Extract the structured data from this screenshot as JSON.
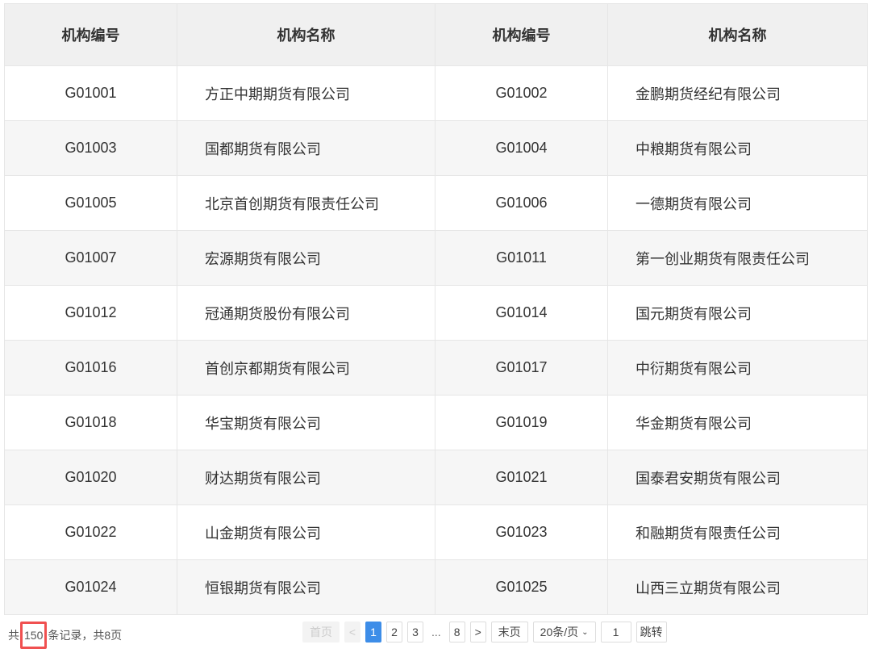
{
  "headers": [
    "机构编号",
    "机构名称",
    "机构编号",
    "机构名称"
  ],
  "rows": [
    [
      "G01001",
      "方正中期期货有限公司",
      "G01002",
      "金鹏期货经纪有限公司"
    ],
    [
      "G01003",
      "国都期货有限公司",
      "G01004",
      "中粮期货有限公司"
    ],
    [
      "G01005",
      "北京首创期货有限责任公司",
      "G01006",
      "一德期货有限公司"
    ],
    [
      "G01007",
      "宏源期货有限公司",
      "G01011",
      "第一创业期货有限责任公司"
    ],
    [
      "G01012",
      "冠通期货股份有限公司",
      "G01014",
      "国元期货有限公司"
    ],
    [
      "G01016",
      "首创京都期货有限公司",
      "G01017",
      "中衍期货有限公司"
    ],
    [
      "G01018",
      "华宝期货有限公司",
      "G01019",
      "华金期货有限公司"
    ],
    [
      "G01020",
      "财达期货有限公司",
      "G01021",
      "国泰君安期货有限公司"
    ],
    [
      "G01022",
      "山金期货有限公司",
      "G01023",
      "和融期货有限责任公司"
    ],
    [
      "G01024",
      "恒银期货有限公司",
      "G01025",
      "山西三立期货有限公司"
    ]
  ],
  "summary": {
    "prefix": "共",
    "total": "150",
    "suffix": "条记录，共8页"
  },
  "pager": {
    "first": "首页",
    "prev": "<",
    "pages": [
      "1",
      "2",
      "3"
    ],
    "ellipsis": "...",
    "last_page": "8",
    "next": ">",
    "last": "末页",
    "page_size": "20条/页",
    "jump_value": "1",
    "jump": "跳转"
  }
}
